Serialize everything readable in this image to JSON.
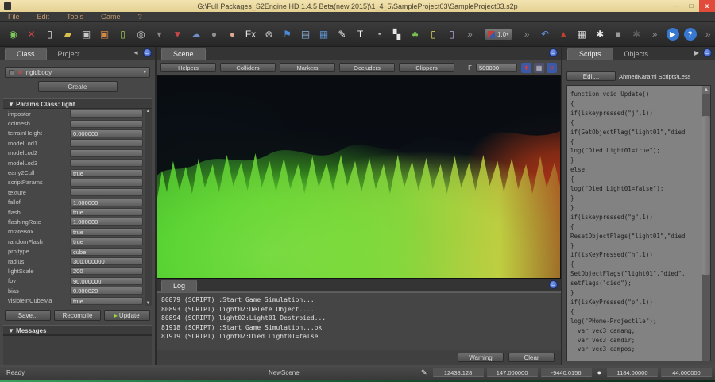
{
  "window": {
    "title": "G:\\Full Packages_S2Engine HD 1.4.5 Beta(new 2015)\\1_4_5\\SampleProject03\\SampleProject03.s2p",
    "controls": {
      "minimize": "–",
      "maximize": "□",
      "close": "x"
    }
  },
  "menu": {
    "items": [
      {
        "label": "File"
      },
      {
        "label": "Edit"
      },
      {
        "label": "Tools"
      },
      {
        "label": "Game"
      },
      {
        "label": "?"
      }
    ]
  },
  "toolbar": {
    "zoom_value": "1.0",
    "icons_left": [
      {
        "name": "scene-globe-icon",
        "glyph": "◉",
        "color": "#7ac85a"
      },
      {
        "name": "close-project-icon",
        "glyph": "✕",
        "color": "#cc4444"
      },
      {
        "name": "new-document-icon",
        "glyph": "▯",
        "color": "#e6e6e6"
      },
      {
        "name": "open-folder-icon",
        "glyph": "▰",
        "color": "#d8c050"
      },
      {
        "name": "save-icon",
        "glyph": "▣",
        "color": "#c8c8c8"
      },
      {
        "name": "save-scene-icon",
        "glyph": "▣",
        "color": "#d08848"
      },
      {
        "name": "add-document-icon",
        "glyph": "▯",
        "color": "#9ac858"
      },
      {
        "name": "disc-icon",
        "glyph": "◎",
        "color": "#c8c8c8"
      },
      {
        "name": "overflow-chevron",
        "glyph": "▾",
        "color": "#8a8a8a"
      },
      {
        "name": "shield-icon",
        "glyph": "▼",
        "color": "#c84848"
      },
      {
        "name": "cloud-icon",
        "glyph": "☁",
        "color": "#7090c8"
      },
      {
        "name": "small-sphere-icon",
        "glyph": "●",
        "color": "#909090"
      },
      {
        "name": "sphere-icon",
        "glyph": "●",
        "color": "#d8a890"
      },
      {
        "name": "fx-icon",
        "glyph": "Fx",
        "color": "#e8e8e8"
      },
      {
        "name": "film-reel-icon",
        "glyph": "⊛",
        "color": "#d8d8d8"
      },
      {
        "name": "flag-icon",
        "glyph": "⚑",
        "color": "#5088d8"
      },
      {
        "name": "clipboard-icon",
        "glyph": "▤",
        "color": "#88b0d8"
      },
      {
        "name": "window-grid-icon",
        "glyph": "▦",
        "color": "#6098d8"
      },
      {
        "name": "edit-note-icon",
        "glyph": "✎",
        "color": "#e8e8e8"
      },
      {
        "name": "text-tool-icon",
        "glyph": "T",
        "color": "#f0f0f0"
      },
      {
        "name": "gauge-icon",
        "glyph": "◔",
        "color": "#c8c8c8"
      },
      {
        "name": "checkerboard-icon",
        "glyph": "▚",
        "color": "#e8e8e8"
      },
      {
        "name": "vegetation-icon",
        "glyph": "♣",
        "color": "#78c050"
      },
      {
        "name": "yellow-note-icon",
        "glyph": "▯",
        "color": "#e8e060"
      },
      {
        "name": "purple-note-icon",
        "glyph": "▯",
        "color": "#c0a8e8"
      },
      {
        "name": "overflow-chevron",
        "glyph": "»",
        "color": "#8a8a8a"
      }
    ],
    "icons_right": [
      {
        "name": "overflow-chevron",
        "glyph": "»",
        "color": "#8a8a8a"
      },
      {
        "name": "undo-icon",
        "glyph": "↶",
        "color": "#6090e0"
      },
      {
        "name": "terrain-icon",
        "glyph": "▲",
        "color": "#c04030"
      },
      {
        "name": "grid-icon",
        "glyph": "▦",
        "color": "#e0e0e0"
      },
      {
        "name": "gear-icon",
        "glyph": "✱",
        "color": "#e8e8e8"
      },
      {
        "name": "screen-icon",
        "glyph": "■",
        "color": "#9a9a9a"
      },
      {
        "name": "gear-disabled-icon",
        "glyph": "✱",
        "color": "#5e5e5e"
      },
      {
        "name": "overflow-chevron",
        "glyph": "»",
        "color": "#8a8a8a"
      },
      {
        "name": "play-icon",
        "glyph": "▶",
        "color": "#ffffff",
        "bg": "#3878d0",
        "round": true
      },
      {
        "name": "help-icon",
        "glyph": "?",
        "color": "#ffffff",
        "bg": "#3878d0",
        "round": true
      },
      {
        "name": "overflow-chevron",
        "glyph": "»",
        "color": "#8a8a8a"
      }
    ]
  },
  "left_panel": {
    "tabs": [
      {
        "label": "Class",
        "active": true
      },
      {
        "label": "Project",
        "active": false
      }
    ],
    "collapse_arrow": "◄",
    "minimize_glyph": "–",
    "class_dropdown": {
      "value": "rigidbody",
      "remove_glyph": "✕",
      "caret": "▾"
    },
    "create_button": "Create",
    "params_header": "▼ Params Class: light",
    "params": [
      {
        "label": "impostor",
        "value": ""
      },
      {
        "label": "colmesh",
        "value": ""
      },
      {
        "label": "terrainHeight",
        "value": "0.000000"
      },
      {
        "label": "modelLod1",
        "value": ""
      },
      {
        "label": "modelLod2",
        "value": ""
      },
      {
        "label": "modelLod3",
        "value": ""
      },
      {
        "label": "early2Cull",
        "value": "true"
      },
      {
        "label": "scriptParams",
        "value": ""
      },
      {
        "label": "texture",
        "value": ""
      },
      {
        "label": "fallof",
        "value": "1.000000"
      },
      {
        "label": "flash",
        "value": "true"
      },
      {
        "label": "flashingRate",
        "value": "1.000000"
      },
      {
        "label": "rotateBox",
        "value": "true"
      },
      {
        "label": "randomFlash",
        "value": "true"
      },
      {
        "label": "projtype",
        "value": "cube"
      },
      {
        "label": "radius",
        "value": "300.000000"
      },
      {
        "label": "lightScale",
        "value": "200"
      },
      {
        "label": "fov",
        "value": "90.000000"
      },
      {
        "label": "bias",
        "value": "0.000020"
      },
      {
        "label": "visibleInCubeMa",
        "value": "true"
      }
    ],
    "scroll_up": "▲",
    "scroll_down": "▼",
    "buttons": {
      "save": "Save...",
      "recompile": "Recompile",
      "update": "Update",
      "update_glyph": "▸"
    },
    "messages_header": "▼ Messages"
  },
  "scene_panel": {
    "tab": "Scene",
    "minimize_glyph": "–",
    "buttons": [
      {
        "label": "Helpers"
      },
      {
        "label": "Colliders"
      },
      {
        "label": "Markers"
      },
      {
        "label": "Occluders"
      },
      {
        "label": "Clippers"
      }
    ],
    "f_label": "F",
    "f_value": "500000",
    "icons": [
      {
        "name": "gizmo-cross-icon",
        "glyph": "✚",
        "color": "#d04040",
        "bg": "#3a5aa8"
      },
      {
        "name": "layers-icon",
        "glyph": "▦",
        "color": "#c8c8c8",
        "bg": "#50506a"
      },
      {
        "name": "close-view-icon",
        "glyph": "✕",
        "color": "#d04040",
        "bg": "#3a5aa8"
      }
    ]
  },
  "log_panel": {
    "tab": "Log",
    "minimize_glyph": "–",
    "lines": [
      "80879 (SCRIPT) :Start Game Simulation...",
      "80893 (SCRIPT) light02:Delete Object....",
      "80894 (SCRIPT) light02:Light01 Destroied...",
      "81918 (SCRIPT) :Start Game Simulation...ok",
      "81919 (SCRIPT) light02:Died Light01=false"
    ],
    "buttons": {
      "warning": "Warning",
      "clear": "Clear"
    }
  },
  "scripts_panel": {
    "tabs": [
      {
        "label": "Scripts",
        "active": true
      },
      {
        "label": "Objects",
        "active": false
      }
    ],
    "expand_arrow": "▶",
    "minimize_glyph": "–",
    "edit_button": "Edit...",
    "path": "AhmedKarami Scripts\\Less",
    "scroll_up": "▲",
    "code_lines": [
      "function void Update()",
      "{",
      "if(iskeypressed(\"j\",1))",
      "{",
      "if(GetObjectFlag(\"light01\",\"died",
      "{",
      "log(\"Died Light01=true\");",
      "}",
      "else",
      "{",
      "log(\"Died Light01=false\");",
      "}",
      "}",
      "if(iskeypressed(\"g\",1))",
      "{",
      "ResetObjectFlags(\"light01\",\"died",
      "}",
      "if(isKeyPressed(\"h\",1))",
      "{",
      "SetObjectFlags(\"light01\",\"died\",",
      "setflags(\"died\");",
      "}",
      "if(isKeyPressed(\"p\",1))",
      "{",
      "log(\"PHome-Projectile\");",
      "  var vec3 camang;",
      "  var vec3 camdir;",
      "  var vec3 campos;"
    ]
  },
  "status_bar": {
    "ready": "Ready",
    "scene_name": "NewScene",
    "pencil_icon": "✎",
    "coords": [
      {
        "value": "12438.128"
      },
      {
        "value": "147.000000"
      },
      {
        "value": "-9440.0156"
      }
    ],
    "dot_icon": "●",
    "coords2": [
      {
        "value": "1184.00000"
      },
      {
        "value": "44.000000"
      }
    ]
  },
  "colors": {
    "titlebar": "#ecd9a0",
    "close_button": "#e04b3c",
    "panel_bg": "#474747",
    "tab_active": "#5c5c5c",
    "accent_blue": "#3a78d8",
    "viewport_green": "#63da34",
    "viewport_red": "#b63418"
  }
}
